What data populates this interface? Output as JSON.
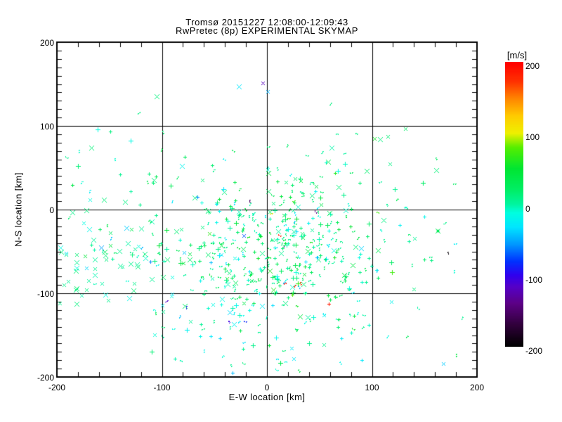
{
  "window": {
    "background": "#ffffff",
    "text_color": "#000000"
  },
  "chart_data": {
    "type": "scatter",
    "title": "Tromsø 20151227 12:08:00-12:09:43",
    "subtitle": "RwPretec (8p) EXPERIMENTAL SKYMAP",
    "xlabel": "E-W location [km]",
    "ylabel": "N-S location [km]",
    "xlim": [
      -200,
      200
    ],
    "ylim": [
      -200,
      200
    ],
    "xticks": [
      -200,
      -100,
      0,
      100,
      200
    ],
    "yticks": [
      200,
      100,
      0,
      -100,
      -200
    ],
    "x_tick_labels": [
      "-200",
      "-100",
      "0",
      "100",
      "200"
    ],
    "y_tick_labels": [
      "200",
      "100",
      "0",
      "-100",
      "-200"
    ],
    "x_minor_step_km": 20,
    "y_minor_step_km": 10,
    "grid": true,
    "frame_color": "#000000",
    "background": "#ffffff",
    "point_count_estimate": 680,
    "colorbar": {
      "label": "[m/s]",
      "min": -200,
      "max": 200,
      "ticks": [
        200,
        100,
        0,
        -100,
        -200
      ],
      "tick_labels": [
        "200",
        "100",
        "0",
        "-100",
        "-200"
      ],
      "stops": [
        [
          0.0,
          "#000000"
        ],
        [
          0.075,
          "#30003a"
        ],
        [
          0.15,
          "#5c0085"
        ],
        [
          0.21,
          "#5500c8"
        ],
        [
          0.25,
          "#3000ee"
        ],
        [
          0.3,
          "#0033ff"
        ],
        [
          0.36,
          "#0099ff"
        ],
        [
          0.42,
          "#00e6ff"
        ],
        [
          0.47,
          "#00ffe0"
        ],
        [
          0.5,
          "#00f5a0"
        ],
        [
          0.55,
          "#00ee66"
        ],
        [
          0.625,
          "#00e632"
        ],
        [
          0.7,
          "#55ee00"
        ],
        [
          0.75,
          "#eef000"
        ],
        [
          0.81,
          "#ffcc00"
        ],
        [
          0.87,
          "#ff8800"
        ],
        [
          0.93,
          "#ff3300"
        ],
        [
          1.0,
          "#ff0000"
        ]
      ]
    },
    "marker_glyphs": [
      "x",
      "plus",
      "arrow"
    ],
    "points": [
      [
        -4,
        151,
        -120,
        "x"
      ],
      [
        1,
        141,
        -48,
        "x"
      ],
      [
        -105,
        135,
        12,
        "x"
      ],
      [
        -167,
        74,
        14,
        "x"
      ],
      [
        -190,
        62,
        6,
        "arrow"
      ],
      [
        -123,
        115,
        10,
        "arrow"
      ],
      [
        61,
        128,
        12,
        "arrow"
      ],
      [
        -99,
        92,
        14,
        "arrow"
      ],
      [
        84,
        92,
        10,
        "arrow"
      ],
      [
        2,
        76,
        16,
        "arrow"
      ],
      [
        19,
        76,
        18,
        "arrow"
      ],
      [
        108,
        84,
        12,
        "x"
      ],
      [
        115,
        87,
        16,
        "x"
      ],
      [
        132,
        97,
        20,
        "x"
      ],
      [
        117,
        55,
        10,
        "x"
      ],
      [
        161,
        47,
        14,
        "x"
      ],
      [
        95,
        46,
        18,
        "x"
      ],
      [
        18,
        33,
        15,
        "x"
      ],
      [
        27,
        37,
        18,
        "x"
      ],
      [
        68,
        27,
        14,
        "x"
      ],
      [
        43,
        17,
        12,
        "x"
      ],
      [
        88,
        32,
        16,
        "plus"
      ],
      [
        26,
        11,
        70,
        "arrow"
      ],
      [
        168,
        -184,
        -40,
        "x"
      ],
      [
        172,
        -50,
        -195,
        "arrow"
      ],
      [
        13,
        -31,
        185,
        "arrow"
      ],
      [
        16,
        -88,
        190,
        "arrow"
      ],
      [
        27,
        -90,
        180,
        "arrow"
      ],
      [
        32,
        -89,
        175,
        "arrow"
      ],
      [
        59,
        -113,
        185,
        "plus"
      ],
      [
        5,
        -4,
        110,
        "arrow"
      ],
      [
        15,
        -46,
        -130,
        "arrow"
      ],
      [
        -17,
        12,
        -155,
        "arrow"
      ],
      [
        47,
        -3,
        -140,
        "arrow"
      ],
      [
        -111,
        -62,
        -60,
        "plus"
      ],
      [
        -95,
        -108,
        -115,
        "arrow"
      ],
      [
        -77,
        -118,
        -95,
        "arrow"
      ],
      [
        -37,
        -133,
        -105,
        "arrow"
      ],
      [
        -20,
        -134,
        -85,
        "arrow"
      ],
      [
        -197,
        -112,
        8,
        "x"
      ],
      [
        -181,
        -113,
        12,
        "x"
      ],
      [
        -151,
        -108,
        6,
        "x"
      ],
      [
        -127,
        -97,
        15,
        "x"
      ],
      [
        -172,
        -96,
        10,
        "x"
      ],
      [
        -99,
        -122,
        5,
        "x"
      ],
      [
        -191,
        -54,
        10,
        "x"
      ],
      [
        -181,
        -54,
        16,
        "x"
      ],
      [
        -181,
        -63,
        4,
        "x"
      ],
      [
        -196,
        -50,
        12,
        "x"
      ],
      [
        -193,
        -90,
        7,
        "x"
      ],
      [
        -180,
        52,
        14,
        "plus"
      ],
      [
        -149,
        93,
        12,
        "plus"
      ],
      [
        -135,
        9,
        10,
        "x"
      ],
      [
        -185,
        -3,
        8,
        "x"
      ],
      [
        -108,
        35,
        12,
        "x"
      ],
      [
        -69,
        14,
        10,
        "x"
      ],
      [
        -41,
        21,
        14,
        "x"
      ],
      [
        -60,
        -170,
        -20,
        "arrow"
      ],
      [
        -35,
        -185,
        5,
        "arrow"
      ],
      [
        10,
        -192,
        -10,
        "arrow"
      ],
      [
        40,
        -160,
        8,
        "plus"
      ],
      [
        115,
        -150,
        -15,
        "arrow"
      ],
      [
        140,
        -95,
        12,
        "x"
      ],
      [
        150,
        -60,
        18,
        "plus"
      ],
      [
        180,
        -40,
        -25,
        "arrow"
      ],
      [
        185,
        -130,
        5,
        "arrow"
      ],
      [
        90,
        -180,
        -30,
        "plus"
      ],
      [
        133,
        2,
        10,
        "arrow"
      ],
      [
        150,
        -8,
        -20,
        "plus"
      ],
      [
        170,
        -15,
        8,
        "arrow"
      ],
      [
        178,
        -75,
        -10,
        "arrow"
      ]
    ],
    "scatter_fill": {
      "seed": 7,
      "clusters": [
        {
          "count": 340,
          "cx": 15,
          "cy": -48,
          "sx": 52,
          "sy": 38,
          "ymax": 92,
          "v_mean": 15,
          "v_sd": 22,
          "markers": [
            [
              "plus",
              0.42
            ],
            [
              "arrow",
              0.42
            ],
            [
              "x",
              0.16
            ]
          ]
        },
        {
          "count": 55,
          "cx": -150,
          "cy": -60,
          "sx": 27,
          "sy": 28,
          "ymax": 195,
          "v_mean": 5,
          "v_sd": 18,
          "markers": [
            [
              "x",
              0.82
            ],
            [
              "plus",
              0.08
            ],
            [
              "arrow",
              0.1
            ]
          ]
        },
        {
          "count": 120,
          "cx": -15,
          "cy": -60,
          "sx": 95,
          "sy": 68,
          "ymax": 195,
          "v_mean": 2,
          "v_sd": 28,
          "markers": [
            [
              "plus",
              0.34
            ],
            [
              "arrow",
              0.44
            ],
            [
              "x",
              0.22
            ]
          ]
        },
        {
          "count": 42,
          "cx": -10,
          "cy": 38,
          "sx": 105,
          "sy": 30,
          "ymax": 110,
          "v_mean": 10,
          "v_sd": 20,
          "markers": [
            [
              "arrow",
              0.5
            ],
            [
              "plus",
              0.3
            ],
            [
              "x",
              0.2
            ]
          ]
        },
        {
          "count": 55,
          "cx": -5,
          "cy": -140,
          "sx": 78,
          "sy": 28,
          "ymax": -100,
          "v_mean": -5,
          "v_sd": 26,
          "markers": [
            [
              "arrow",
              0.5
            ],
            [
              "plus",
              0.38
            ],
            [
              "x",
              0.12
            ]
          ]
        }
      ]
    }
  }
}
